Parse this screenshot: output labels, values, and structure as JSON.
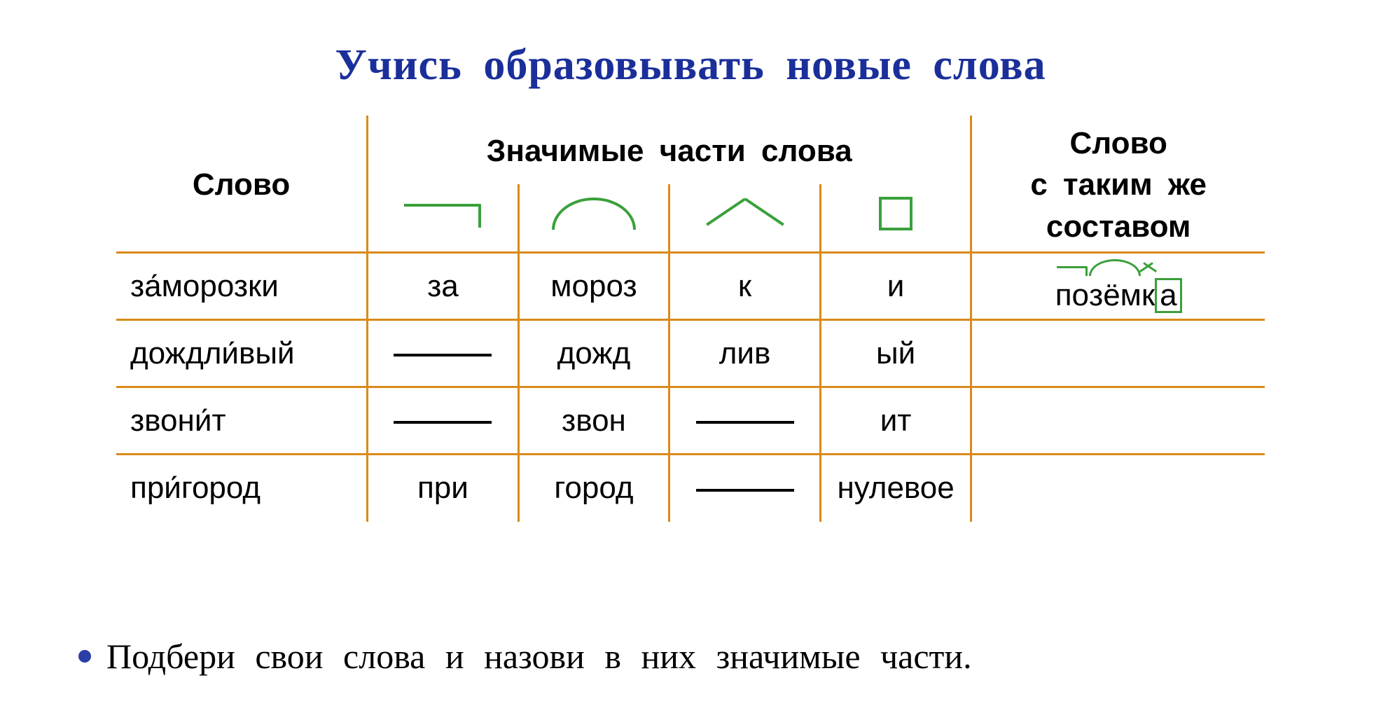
{
  "title": "Учись  образовывать  новые  слова",
  "headers": {
    "word": "Слово",
    "parts": "Значимые  части  слова",
    "same": "Слово\nс  таким  же\nсоставом"
  },
  "morpheme_symbols": {
    "prefix": "prefix-symbol",
    "root": "root-symbol",
    "suffix": "suffix-symbol",
    "ending": "ending-symbol"
  },
  "rows": [
    {
      "word": "за́морозки",
      "prefix": "за",
      "root": "мороз",
      "suffix": "к",
      "ending": "и",
      "same": {
        "prefix": "по",
        "root": "зём",
        "suffix": "к",
        "ending": "а"
      }
    },
    {
      "word": "дождли́вый",
      "prefix": null,
      "root": "дожд",
      "suffix": "лив",
      "ending": "ый",
      "same": null
    },
    {
      "word": "звони́т",
      "prefix": null,
      "root": "звон",
      "suffix": null,
      "ending": "ит",
      "same": null
    },
    {
      "word": "при́город",
      "prefix": "при",
      "root": "город",
      "suffix": null,
      "ending": "нулевое",
      "same": null
    }
  ],
  "task": "Подбери  свои  слова  и  назови  в  них  значимые  части."
}
